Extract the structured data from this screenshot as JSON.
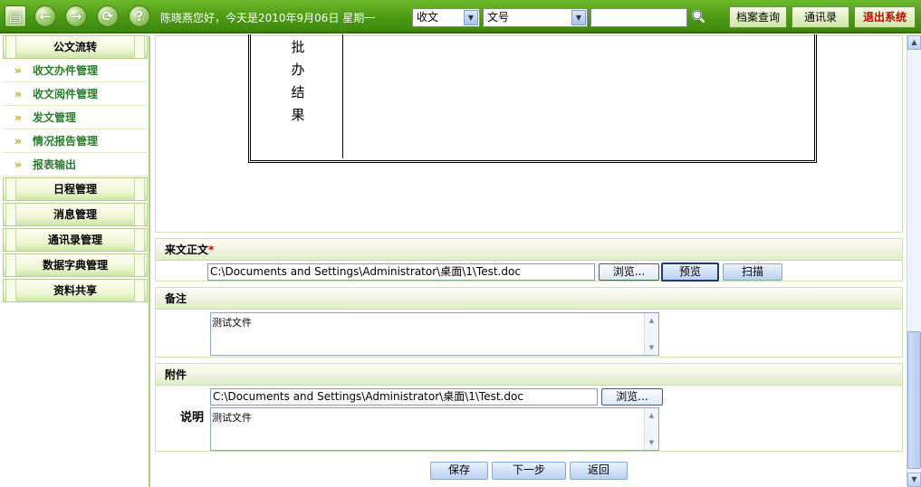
{
  "header": {
    "greeting": "陈晓燕您好，今天是2010年9月06日 星期一",
    "select1": "收文",
    "select2": "文号",
    "search_value": "",
    "buttons": {
      "archive": "档案查询",
      "contacts": "通讯录",
      "logout": "退出系统"
    },
    "icons": [
      "document-icon",
      "back-icon",
      "forward-icon",
      "refresh-icon",
      "help-icon"
    ]
  },
  "sidebar": {
    "sections": [
      {
        "label": "公文流转"
      },
      {
        "label": "日程管理"
      },
      {
        "label": "消息管理"
      },
      {
        "label": "通讯录管理"
      },
      {
        "label": "数据字典管理"
      },
      {
        "label": "资料共享"
      }
    ],
    "items": [
      {
        "label": "收文办件管理"
      },
      {
        "label": "收文阅件管理"
      },
      {
        "label": "发文管理"
      },
      {
        "label": "情况报告管理"
      },
      {
        "label": "报表输出"
      }
    ]
  },
  "doc": {
    "result_chars": [
      "批",
      "办",
      "结",
      "果"
    ]
  },
  "incoming": {
    "title": "来文正文",
    "required_mark": "*",
    "path": "C:\\Documents and Settings\\Administrator\\桌面\\1\\Test.doc",
    "browse": "浏览...",
    "preview": "预览",
    "scan": "扫描"
  },
  "remark": {
    "title": "备注",
    "text": "测试文件"
  },
  "attachment": {
    "title": "附件",
    "path": "C:\\Documents and Settings\\Administrator\\桌面\\1\\Test.doc",
    "browse": "浏览...",
    "desc_label": "说明",
    "desc_text": "测试文件"
  },
  "footer": {
    "save": "保存",
    "next": "下一步",
    "back": "返回"
  }
}
